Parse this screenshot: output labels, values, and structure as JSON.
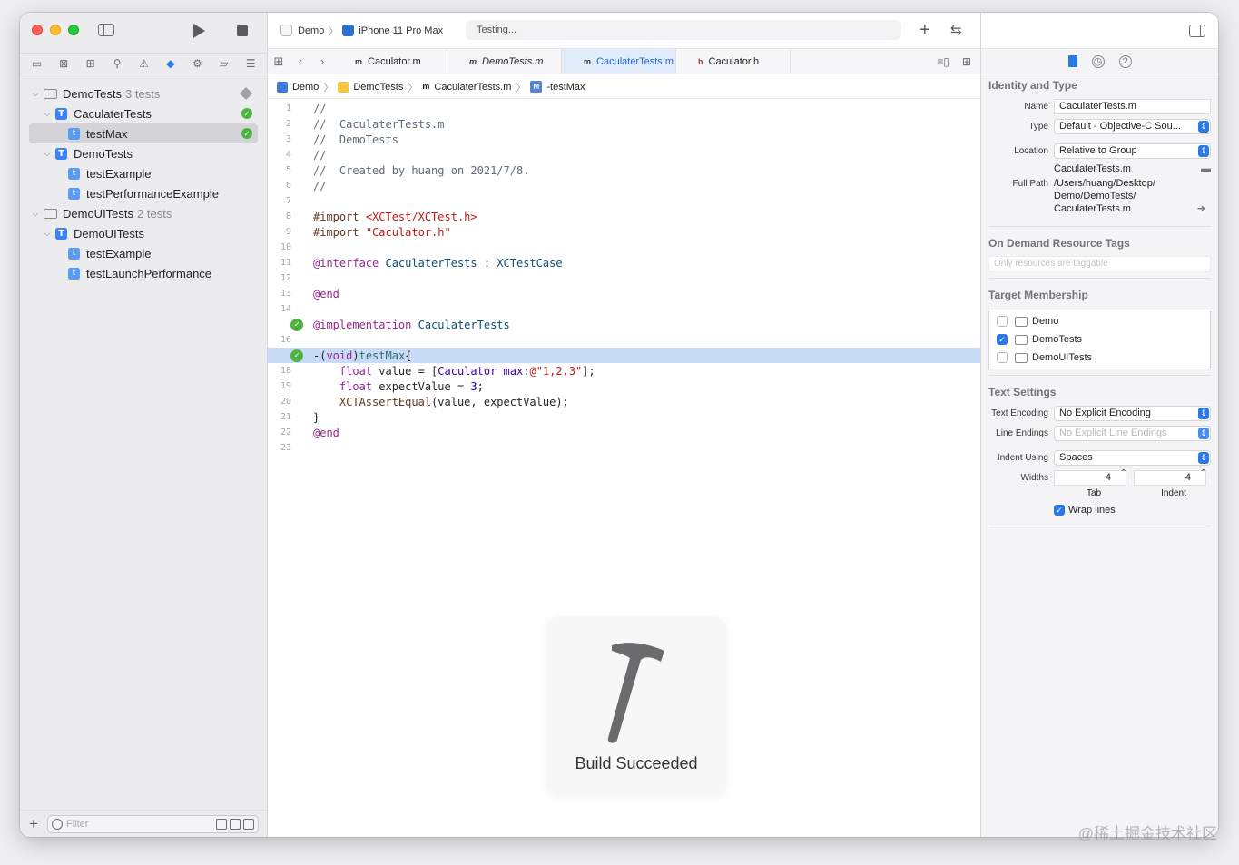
{
  "toolbar": {
    "scheme_target": "Demo",
    "scheme_device": "iPhone 11 Pro Max",
    "activity_status": "Testing..."
  },
  "sidebar": {
    "tree": [
      {
        "label": "DemoTests",
        "sub": "3 tests",
        "level": 0,
        "kind": "folder",
        "status": "diamond"
      },
      {
        "label": "CaculaterTests",
        "sub": "",
        "level": 1,
        "kind": "class",
        "status": "pass"
      },
      {
        "label": "testMax",
        "sub": "",
        "level": 2,
        "kind": "method",
        "status": "pass",
        "selected": true
      },
      {
        "label": "DemoTests",
        "sub": "",
        "level": 1,
        "kind": "class",
        "status": ""
      },
      {
        "label": "testExample",
        "sub": "",
        "level": 2,
        "kind": "method",
        "status": ""
      },
      {
        "label": "testPerformanceExample",
        "sub": "",
        "level": 2,
        "kind": "method",
        "status": ""
      },
      {
        "label": "DemoUITests",
        "sub": "2 tests",
        "level": 0,
        "kind": "folder",
        "status": ""
      },
      {
        "label": "DemoUITests",
        "sub": "",
        "level": 1,
        "kind": "class",
        "status": ""
      },
      {
        "label": "testExample",
        "sub": "",
        "level": 2,
        "kind": "method",
        "status": ""
      },
      {
        "label": "testLaunchPerformance",
        "sub": "",
        "level": 2,
        "kind": "method",
        "status": ""
      }
    ],
    "filter_placeholder": "Filter"
  },
  "tabs": [
    {
      "file_icon": "m",
      "label": "Caculator.m",
      "active": false,
      "italic": false
    },
    {
      "file_icon": "m",
      "label": "DemoTests.m",
      "active": false,
      "italic": true
    },
    {
      "file_icon": "m",
      "label": "CaculaterTests.m",
      "active": true,
      "italic": false
    },
    {
      "file_icon": "h",
      "label": "Caculator.h",
      "active": false,
      "italic": false
    }
  ],
  "jumpbar": {
    "project": "Demo",
    "group": "DemoTests",
    "file": "CaculaterTests.m",
    "symbol": "-testMax"
  },
  "code_lines": [
    "//",
    "//  CaculaterTests.m",
    "//  DemoTests",
    "//",
    "//  Created by huang on 2021/7/8.",
    "//",
    "",
    "#import <XCTest/XCTest.h>",
    "#import \"Caculator.h\"",
    "",
    "@interface CaculaterTests : XCTestCase",
    "",
    "@end",
    "",
    "@implementation CaculaterTests",
    "",
    "-(void)testMax{",
    "    float value = [Caculator max:@\"1,2,3\"];",
    "    float expectValue = 3;",
    "    XCTAssertEqual(value, expectValue);",
    "}",
    "@end",
    ""
  ],
  "hud": {
    "label": "Build Succeeded"
  },
  "inspector": {
    "identity_title": "Identity and Type",
    "name_label": "Name",
    "name_value": "CaculaterTests.m",
    "type_label": "Type",
    "type_value": "Default - Objective-C Sou...",
    "location_label": "Location",
    "location_value": "Relative to Group",
    "location_file": "CaculaterTests.m",
    "fullpath_label": "Full Path",
    "fullpath_lines": [
      "/Users/huang/Desktop/",
      "Demo/DemoTests/",
      "CaculaterTests.m"
    ],
    "odr_title": "On Demand Resource Tags",
    "odr_placeholder": "Only resources are taggable",
    "membership_title": "Target Membership",
    "targets": [
      {
        "label": "Demo",
        "checked": false
      },
      {
        "label": "DemoTests",
        "checked": true
      },
      {
        "label": "DemoUITests",
        "checked": false
      }
    ],
    "text_settings_title": "Text Settings",
    "encoding_label": "Text Encoding",
    "encoding_value": "No Explicit Encoding",
    "endings_label": "Line Endings",
    "endings_value": "No Explicit Line Endings",
    "indent_label": "Indent Using",
    "indent_value": "Spaces",
    "widths_label": "Widths",
    "tab_width": "4",
    "indent_width": "4",
    "tab_caption": "Tab",
    "indent_caption": "Indent",
    "wrap_label": "Wrap lines"
  },
  "watermark": "@稀土掘金技术社区",
  "colors": {
    "accent": "#2a78ea",
    "pass": "#4fb344",
    "highlight": "#c9dcf7"
  }
}
